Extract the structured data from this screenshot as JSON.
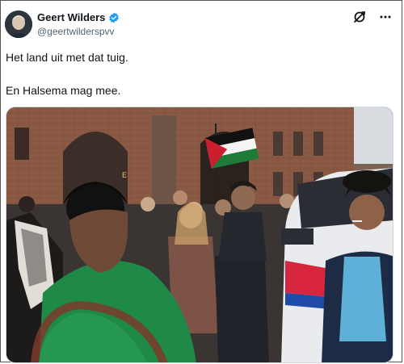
{
  "tweet": {
    "author_name": "Geert Wilders",
    "author_handle": "@geertwilderspvv",
    "lines": [
      "Het land uit met dat tuig.",
      "En Halsema mag mee."
    ],
    "verified": true
  },
  "icons": {
    "verified": "verified-badge-icon",
    "grok": "grok-icon",
    "more": "more-options-icon"
  },
  "media": {
    "description_tags": [
      "protest-photo"
    ],
    "signage": "E"
  },
  "colors": {
    "verified_blue": "#1d9bf0",
    "text": "#0f1419",
    "muted": "#536471"
  }
}
